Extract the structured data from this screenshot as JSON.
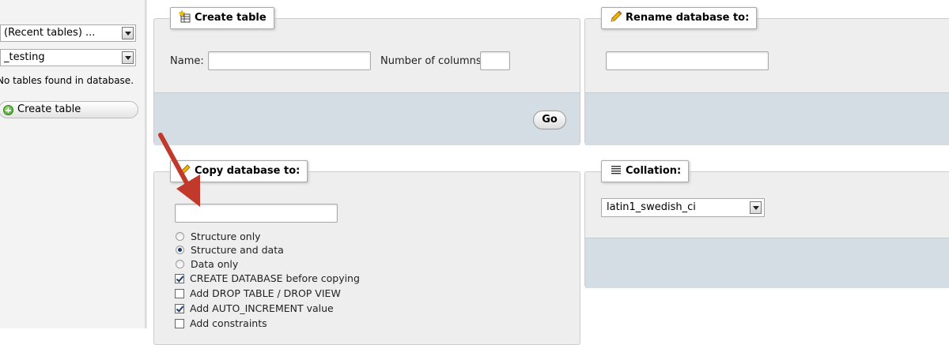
{
  "sidebar": {
    "recent_tables": "(Recent tables) ...",
    "database_select": "_testing",
    "no_tables_text": "No tables found in database.",
    "create_table_label": "Create table"
  },
  "create_table": {
    "legend": "Create table",
    "name_label": "Name:",
    "name_value": "",
    "columns_label": "Number of columns:",
    "columns_value": "",
    "go_label": "Go"
  },
  "rename_db": {
    "legend": "Rename database to:",
    "value": ""
  },
  "copy_db": {
    "legend": "Copy database to:",
    "value": "",
    "radios": [
      {
        "label": "Structure only",
        "checked": false
      },
      {
        "label": "Structure and data",
        "checked": true
      },
      {
        "label": "Data only",
        "checked": false
      }
    ],
    "checkboxes": [
      {
        "label": "CREATE DATABASE before copying",
        "checked": true
      },
      {
        "label": "Add DROP TABLE / DROP VIEW",
        "checked": false
      },
      {
        "label": "Add AUTO_INCREMENT value",
        "checked": true
      },
      {
        "label": "Add constraints",
        "checked": false
      }
    ]
  },
  "collation": {
    "legend": "Collation:",
    "selected": "latin1_swedish_ci"
  },
  "colors": {
    "panel_bg": "#eeeeee",
    "footer_bg": "#d5dde4",
    "annotation_arrow": "#c0392b"
  }
}
